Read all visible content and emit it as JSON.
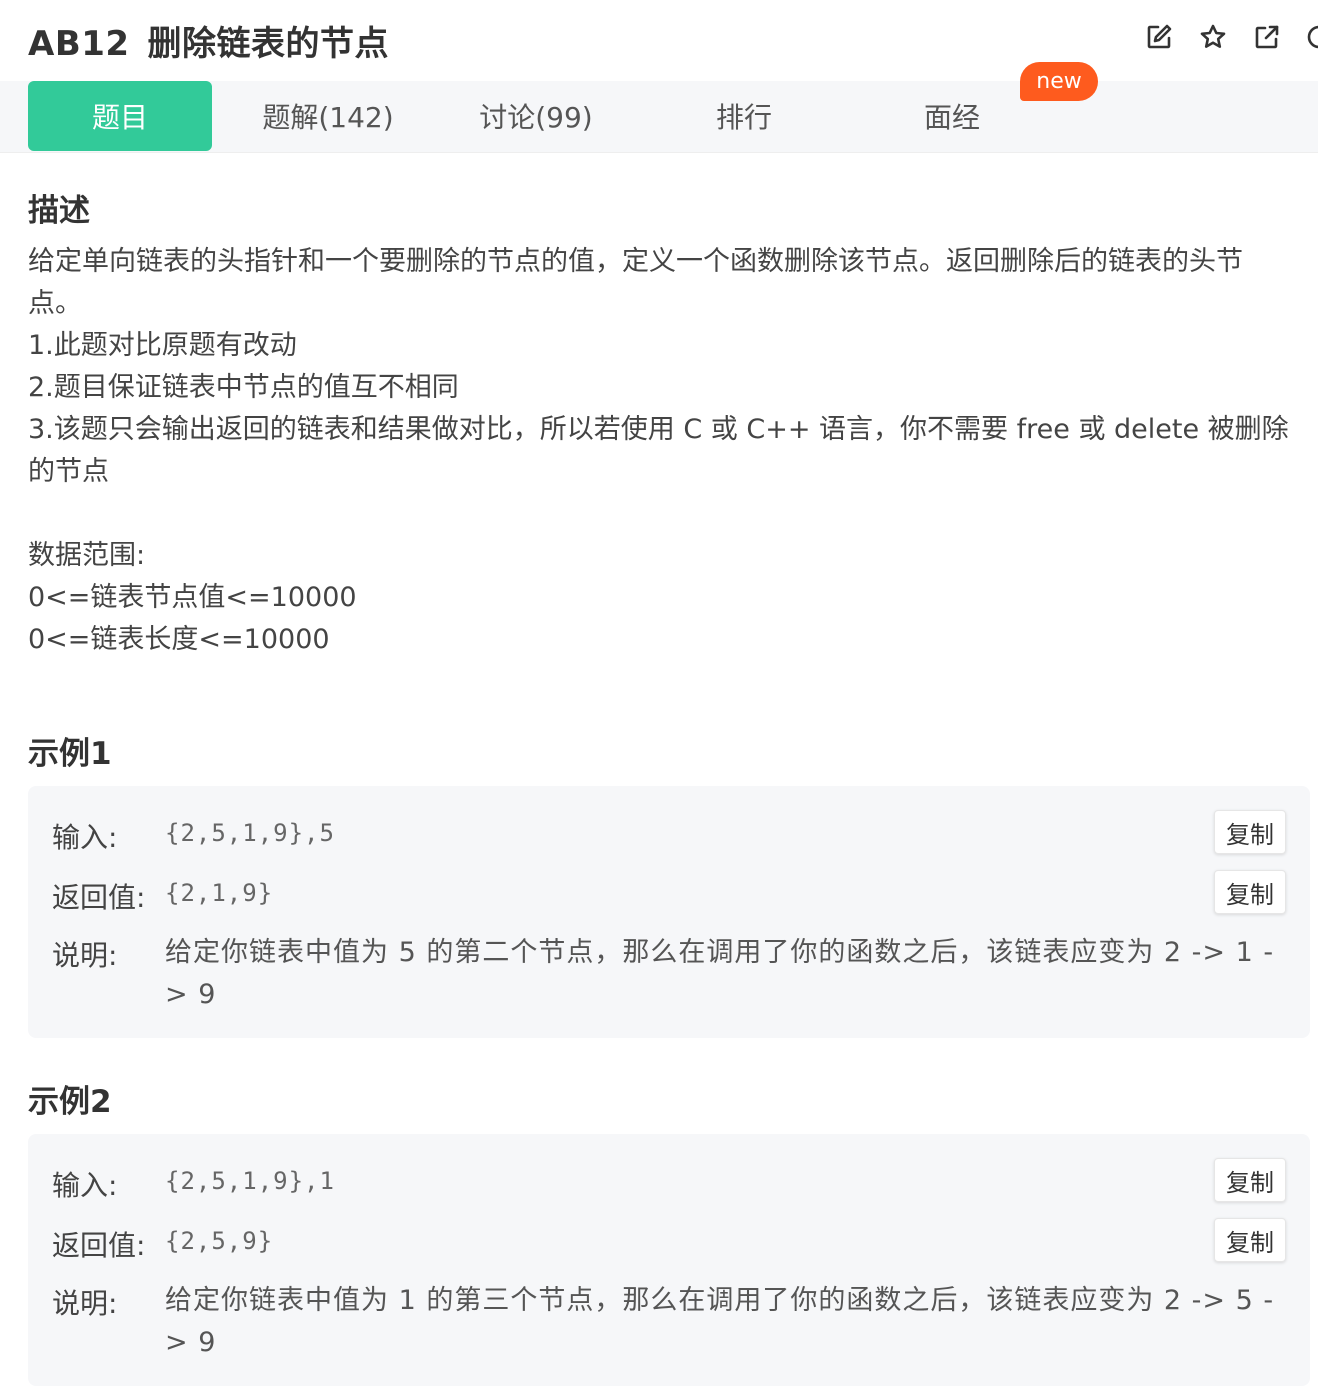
{
  "header": {
    "problem_id": "AB12",
    "problem_title": "删除链表的节点"
  },
  "tabs": [
    {
      "label": "题目",
      "active": true
    },
    {
      "label": "题解(142)",
      "active": false
    },
    {
      "label": "讨论(99)",
      "active": false
    },
    {
      "label": "排行",
      "active": false
    },
    {
      "label": "面经",
      "active": false
    }
  ],
  "new_badge": "new",
  "description": {
    "heading": "描述",
    "lines": [
      "给定单向链表的头指针和一个要删除的节点的值，定义一个函数删除该节点。返回删除后的链表的头节点。",
      "1.此题对比原题有改动",
      "2.题目保证链表中节点的值互不相同",
      "3.该题只会输出返回的链表和结果做对比，所以若使用 C 或 C++ 语言，你不需要 free 或 delete 被删除的节点",
      "",
      "数据范围:",
      "0<=链表节点值<=10000",
      "0<=链表长度<=10000"
    ]
  },
  "examples": [
    {
      "heading": "示例1",
      "input_label": "输入:",
      "input": "{2,5,1,9},5",
      "output_label": "返回值:",
      "output": "{2,1,9}",
      "explain_label": "说明:",
      "explain": "给定你链表中值为 5 的第二个节点，那么在调用了你的函数之后，该链表应变为 2 -> 1 -> 9",
      "copy_label": "复制"
    },
    {
      "heading": "示例2",
      "input_label": "输入:",
      "input": "{2,5,1,9},1",
      "output_label": "返回值:",
      "output": "{2,5,9}",
      "explain_label": "说明:",
      "explain": "给定你链表中值为 1 的第三个节点，那么在调用了你的函数之后，该链表应变为 2 -> 5 -> 9",
      "copy_label": "复制"
    }
  ],
  "icons": [
    "edit-icon",
    "star-icon",
    "external-link-icon",
    "more-icon"
  ],
  "colors": {
    "accent": "#32ca99",
    "badge": "#fe5b1e",
    "panel": "#f6f7f9"
  }
}
